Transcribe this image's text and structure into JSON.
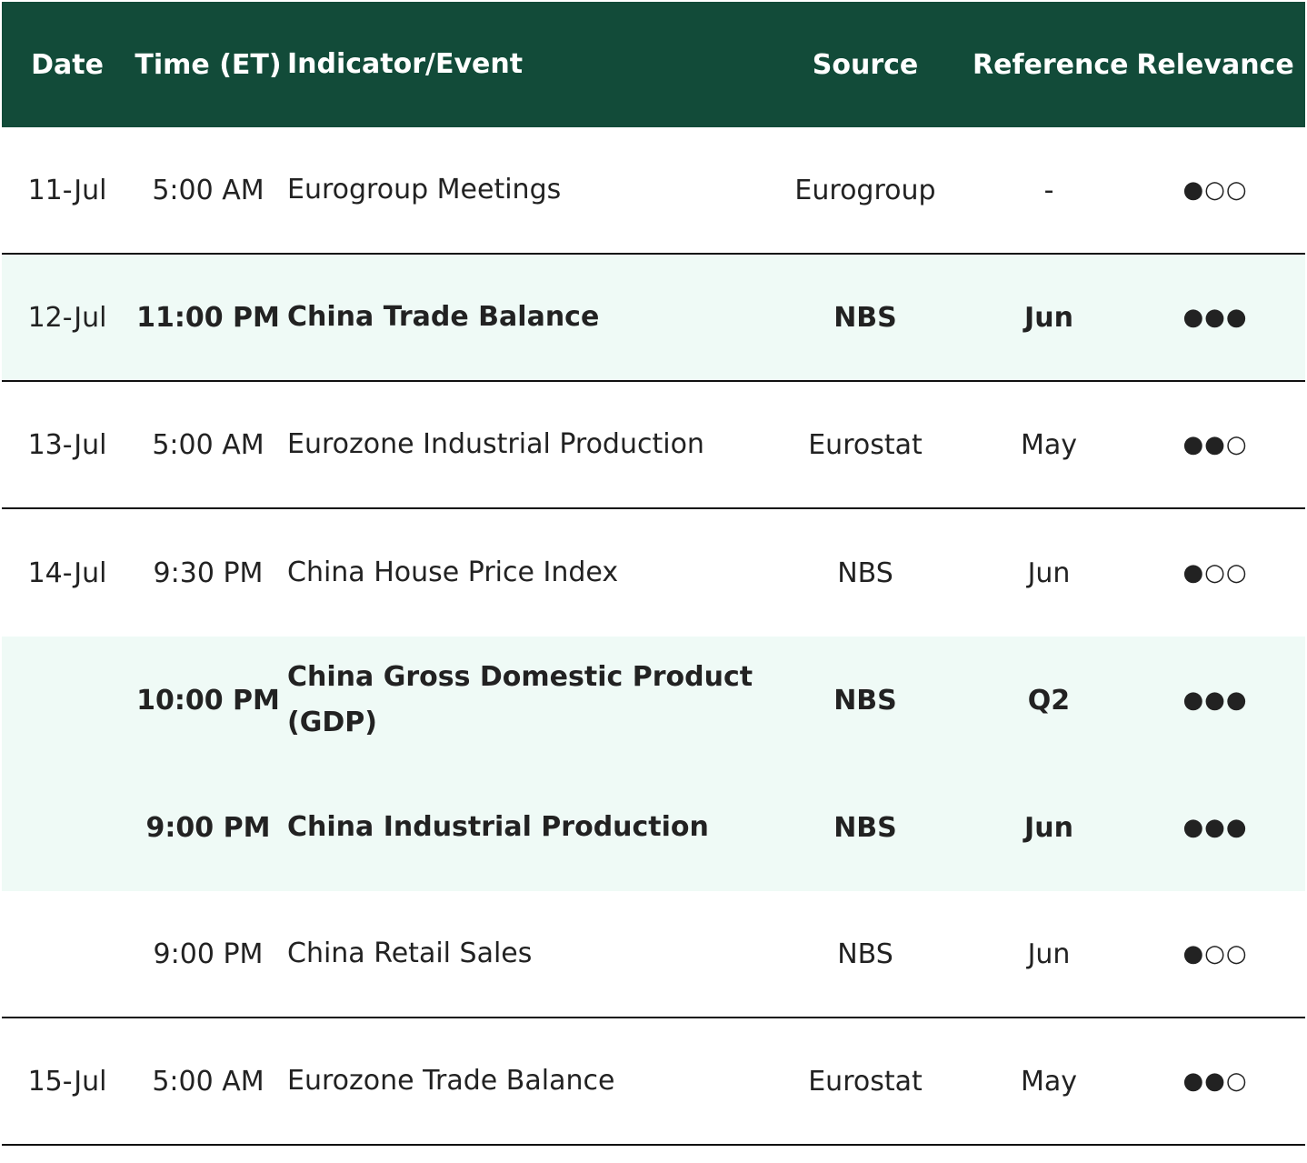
{
  "header": {
    "date": "Date",
    "time": "Time (ET)",
    "event": "Indicator/Event",
    "source": "Source",
    "reference": "Reference",
    "relevance": "Relevance"
  },
  "rows": [
    {
      "date": "11-Jul",
      "time": "5:00 AM",
      "event": "Eurogroup Meetings",
      "source": "Eurogroup",
      "reference": "-",
      "relevance": "●○○",
      "highlight": false
    },
    {
      "date": "12-Jul",
      "time": "11:00 PM",
      "event": "China Trade Balance",
      "source": "NBS",
      "reference": "Jun",
      "relevance": "●●●",
      "highlight": true
    },
    {
      "date": "13-Jul",
      "time": "5:00 AM",
      "event": "Eurozone Industrial Production",
      "source": "Eurostat",
      "reference": "May",
      "relevance": "●●○",
      "highlight": false
    },
    {
      "date": "14-Jul",
      "time": "9:30 PM",
      "event": "China House Price Index",
      "source": "NBS",
      "reference": "Jun",
      "relevance": "●○○",
      "highlight": false
    },
    {
      "date": "",
      "time": "10:00 PM",
      "event": "China Gross Domestic Product (GDP)",
      "source": "NBS",
      "reference": "Q2",
      "relevance": "●●●",
      "highlight": true
    },
    {
      "date": "",
      "time": "9:00 PM",
      "event": "China Industrial Production",
      "source": "NBS",
      "reference": "Jun",
      "relevance": "●●●",
      "highlight": true
    },
    {
      "date": "",
      "time": "9:00 PM",
      "event": "China Retail Sales",
      "source": "NBS",
      "reference": "Jun",
      "relevance": "●○○",
      "highlight": false
    },
    {
      "date": "15-Jul",
      "time": "5:00 AM",
      "event": "Eurozone Trade Balance",
      "source": "Eurostat",
      "reference": "May",
      "relevance": "●●○",
      "highlight": false
    }
  ],
  "colors": {
    "header_bg": "#124b39",
    "highlight_bg": "#effaf6",
    "text": "#222222"
  }
}
